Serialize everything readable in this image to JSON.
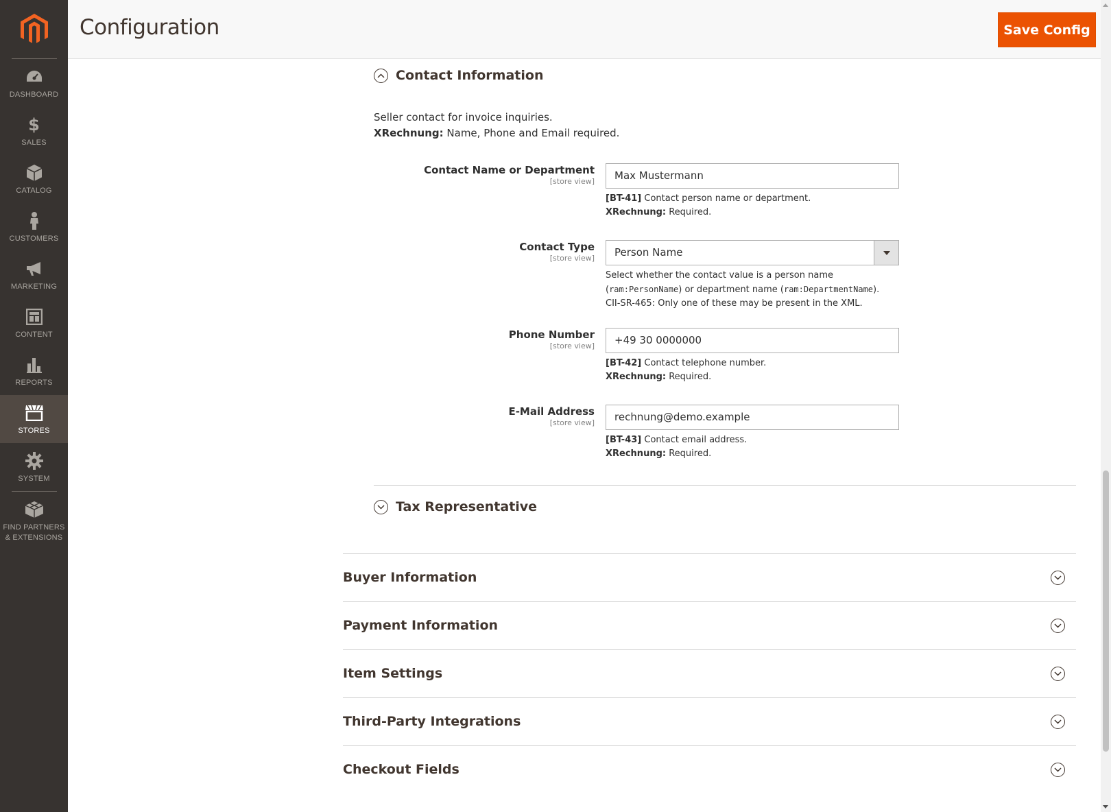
{
  "sidebar": {
    "items": [
      {
        "label": "DASHBOARD",
        "icon": "dashboard-icon"
      },
      {
        "label": "SALES",
        "icon": "dollar-icon"
      },
      {
        "label": "CATALOG",
        "icon": "box-icon"
      },
      {
        "label": "CUSTOMERS",
        "icon": "person-icon"
      },
      {
        "label": "MARKETING",
        "icon": "megaphone-icon"
      },
      {
        "label": "CONTENT",
        "icon": "layout-icon"
      },
      {
        "label": "REPORTS",
        "icon": "bar-chart-icon"
      },
      {
        "label": "STORES",
        "icon": "storefront-icon",
        "active": true
      },
      {
        "label": "SYSTEM",
        "icon": "gear-icon"
      }
    ],
    "partners": {
      "line1": "FIND PARTNERS",
      "line2": "& EXTENSIONS",
      "icon": "blocks-icon"
    }
  },
  "header": {
    "title": "Configuration",
    "save_label": "Save Config"
  },
  "contact_section": {
    "title": "Contact Information",
    "description_line1": "Seller contact for invoice inquiries.",
    "description_bold": "XRechnung:",
    "description_line2": " Name, Phone and Email required."
  },
  "fields": {
    "contact_name": {
      "label": "Contact Name or Department",
      "scope": "[store view]",
      "value": "Max Mustermann",
      "note_code": "[BT-41]",
      "note_text": " Contact person name or department.",
      "note_bold": "XRechnung:",
      "note_req": " Required."
    },
    "contact_type": {
      "label": "Contact Type",
      "scope": "[store view]",
      "value": "Person Name",
      "note_line1": "Select whether the contact value is a person name",
      "note_open": "(",
      "note_code1": "ram:PersonName",
      "note_mid": ") or department name (",
      "note_code2": "ram:DepartmentName",
      "note_close": ").",
      "note_line3": "CII-SR-465: Only one of these may be present in the XML."
    },
    "phone": {
      "label": "Phone Number",
      "scope": "[store view]",
      "value": "+49 30 0000000",
      "note_code": "[BT-42]",
      "note_text": " Contact telephone number.",
      "note_bold": "XRechnung:",
      "note_req": " Required."
    },
    "email": {
      "label": "E-Mail Address",
      "scope": "[store view]",
      "value": "rechnung@demo.example",
      "note_code": "[BT-43]",
      "note_text": " Contact email address.",
      "note_bold": "XRechnung:",
      "note_req": " Required."
    }
  },
  "tax_section": {
    "title": "Tax Representative"
  },
  "groups": [
    {
      "title": "Buyer Information"
    },
    {
      "title": "Payment Information"
    },
    {
      "title": "Item Settings"
    },
    {
      "title": "Third-Party Integrations"
    },
    {
      "title": "Checkout Fields"
    }
  ],
  "colors": {
    "accent": "#eb5202",
    "sidebar_bg": "#373330",
    "sidebar_active": "#514943"
  }
}
